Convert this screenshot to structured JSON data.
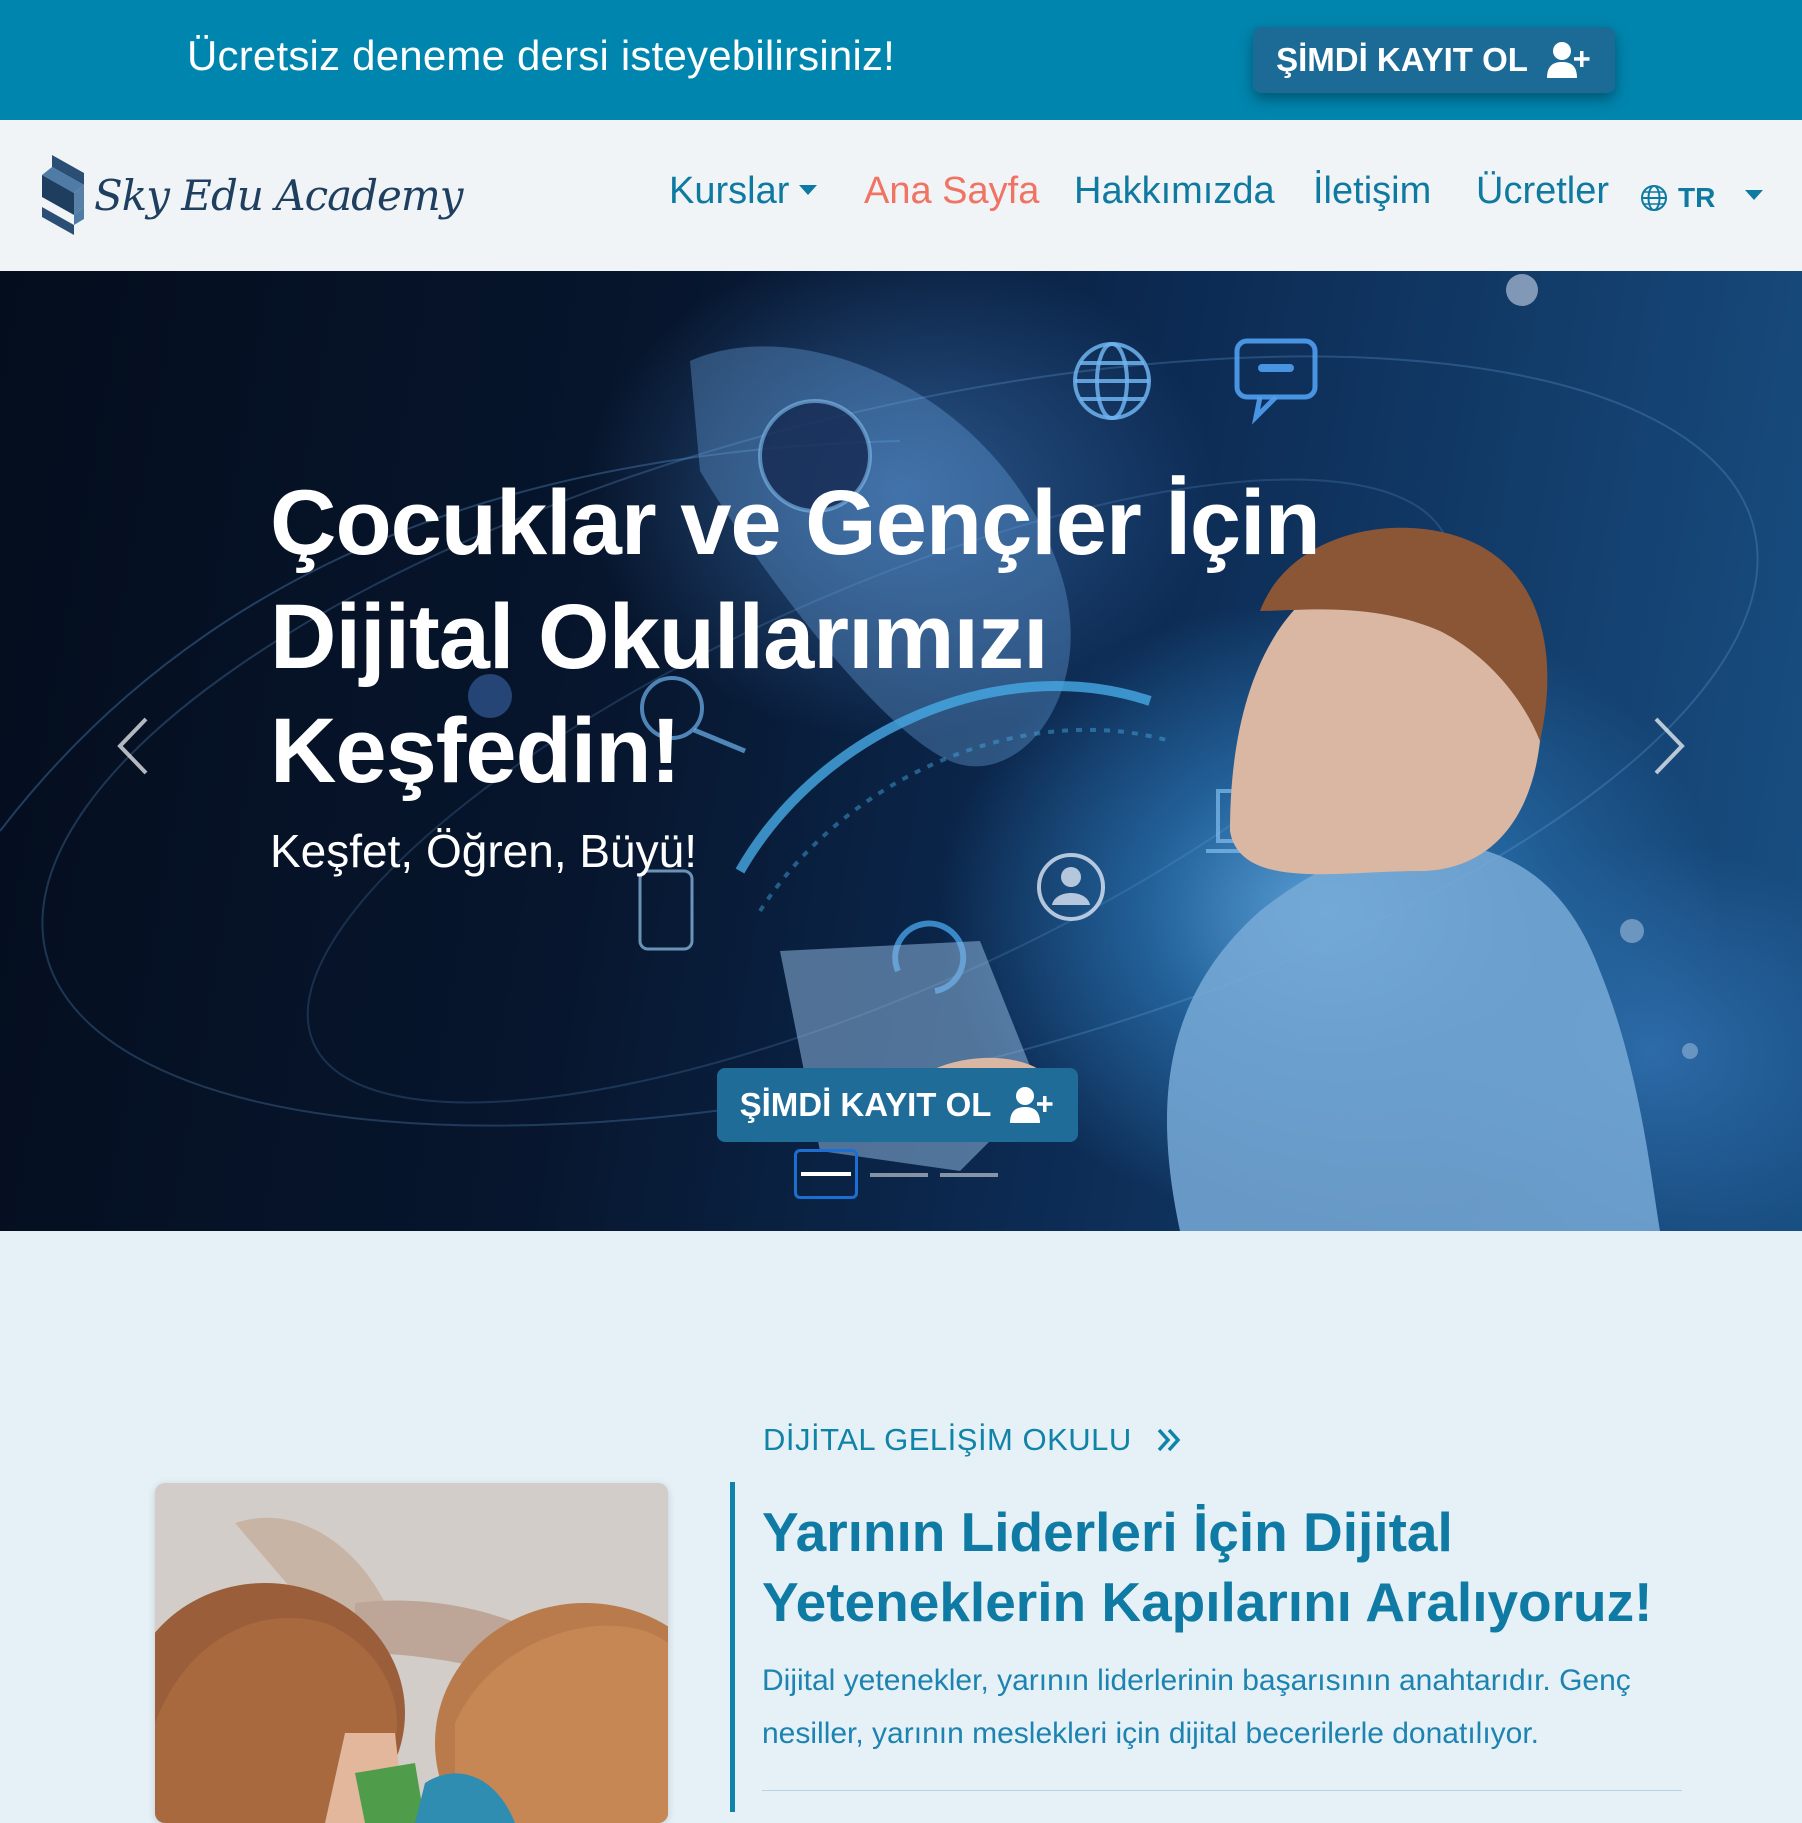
{
  "promo": {
    "text": "Ücretsiz deneme dersi isteyebilirsiniz!",
    "button_label": "ŞİMDİ KAYIT OL",
    "button_icon": "user-plus-icon"
  },
  "navbar": {
    "logo_text": "Sky Edu Academy",
    "links": [
      {
        "label": "Kurslar",
        "has_dropdown": true
      },
      {
        "label": "Ana Sayfa",
        "active": true
      },
      {
        "label": "Hakkımızda"
      },
      {
        "label": "İletişim"
      },
      {
        "label": "Ücretler"
      }
    ],
    "language": {
      "label": "TR",
      "icon": "globe-icon"
    }
  },
  "hero": {
    "title_lines": [
      "Çocuklar ve Gençler İçin",
      "Dijital Okullarımızı",
      "Keşfedin!"
    ],
    "subtitle": "Keşfet, Öğren, Büyü!",
    "button_label": "ŞİMDİ KAYIT OL",
    "button_icon": "user-plus-icon",
    "slides": 3,
    "active_slide": 1
  },
  "section": {
    "eyebrow": "DİJİTAL GELİŞİM OKULU",
    "eyebrow_icon": "double-chevron-right-icon",
    "heading_lines": [
      "Yarının Liderleri İçin Dijital",
      "Yeteneklerin Kapılarını Aralıyoruz!"
    ],
    "text_lines": [
      "Dijital yetenekler, yarının liderlerinin başarısının anahtarıdır. Genç",
      "nesiller, yarının meslekleri için dijital becerilerle donatılıyor."
    ]
  },
  "colors": {
    "primary": "#0085ae",
    "button": "#1c6b96",
    "active_link": "#f07363",
    "link": "#0e7aa1"
  }
}
